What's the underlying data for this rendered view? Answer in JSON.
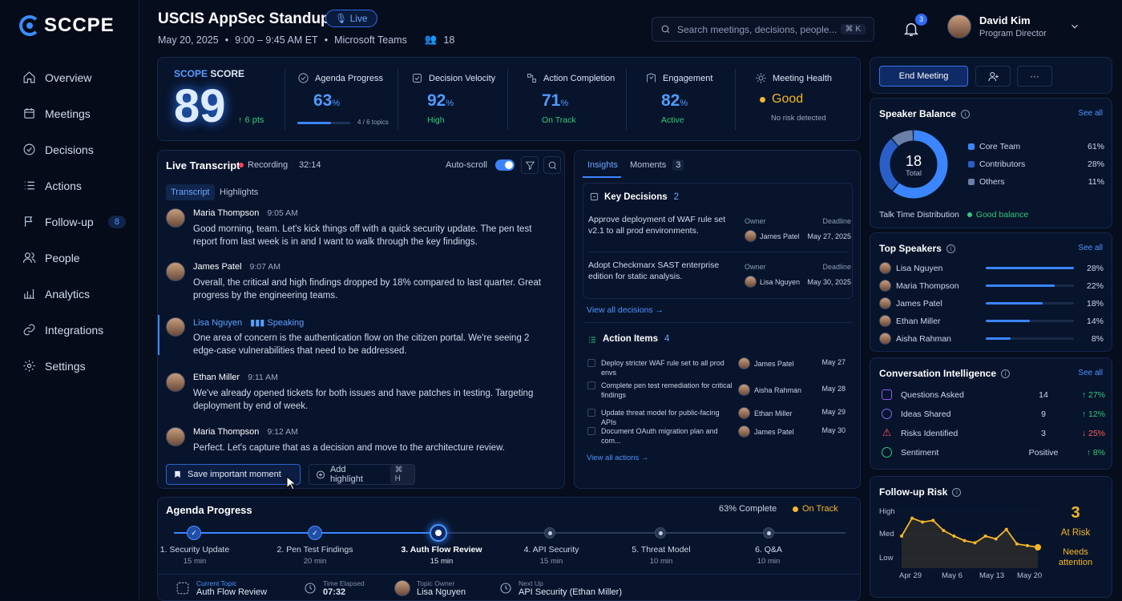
{
  "brand": {
    "logo_text": "SCCPE"
  },
  "nav": [
    {
      "label": "Overview",
      "icon": "home-icon"
    },
    {
      "label": "Meetings",
      "icon": "calendar-icon"
    },
    {
      "label": "Decisions",
      "icon": "check-circle-icon"
    },
    {
      "label": "Actions",
      "icon": "list-icon"
    },
    {
      "label": "Follow-up",
      "icon": "flag-icon",
      "badge": "8"
    },
    {
      "label": "People",
      "icon": "people-icon"
    },
    {
      "label": "Analytics",
      "icon": "analytics-icon"
    },
    {
      "label": "Integrations",
      "icon": "link-icon"
    },
    {
      "label": "Settings",
      "icon": "gear-icon"
    }
  ],
  "header": {
    "title": "USCIS AppSec Standup",
    "live": "Live",
    "date": "May 20, 2025",
    "time": "9:00 – 9:45 AM ET",
    "platform": "Microsoft Teams",
    "attendees": "18",
    "search_placeholder": "Search meetings, decisions, people...",
    "search_kbd": "⌘ K",
    "notifications": "3",
    "user_name": "David Kim",
    "user_role": "Program Director"
  },
  "kpi": {
    "scope_label_a": "SCOPE",
    "scope_label_b": "SCORE",
    "scope_value": "89",
    "scope_delta": "↑ 6 pts",
    "agenda": {
      "label": "Agenda Progress",
      "value": "63",
      "unit": "%",
      "sub": "4 / 6 topics",
      "fraction": 0.63
    },
    "velocity": {
      "label": "Decision Velocity",
      "value": "92",
      "unit": "%",
      "sub": "High"
    },
    "completion": {
      "label": "Action Completion",
      "value": "71",
      "unit": "%",
      "sub": "On Track"
    },
    "engagement": {
      "label": "Engagement",
      "value": "82",
      "unit": "%",
      "sub": "Active"
    },
    "health": {
      "label": "Meeting Health",
      "value": "Good",
      "sub": "No risk detected"
    }
  },
  "transcript": {
    "title": "Live Transcript",
    "recording": "Recording",
    "timer": "32:14",
    "autoscroll": "Auto-scroll",
    "tab_transcript": "Transcript",
    "tab_highlights": "Highlights",
    "messages": [
      {
        "name": "Maria Thompson",
        "time": "9:05 AM",
        "text": "Good morning, team. Let's kick things off with a quick security update. The pen test report from last week is in and I want to walk through the key findings."
      },
      {
        "name": "James Patel",
        "time": "9:07 AM",
        "text": "Overall, the critical and high findings dropped by 18% compared to last quarter. Great progress by the engineering teams."
      },
      {
        "name": "Lisa Nguyen",
        "time": "Speaking",
        "text": "One area of concern is the authentication flow on the citizen portal. We're seeing 2 edge-case vulnerabilities that need to be addressed."
      },
      {
        "name": "Ethan Miller",
        "time": "9:11 AM",
        "text": "We've already opened tickets for both issues and have patches in testing. Targeting deployment by end of week."
      },
      {
        "name": "Maria Thompson",
        "time": "9:12 AM",
        "text": "Perfect. Let's capture that as a decision and move to the architecture review."
      }
    ],
    "save_label": "Save important moment",
    "highlight_label": "Add highlight",
    "highlight_kbd": "⌘ H"
  },
  "insights": {
    "tab_insights": "Insights",
    "tab_moments": "Moments",
    "moments_count": "3",
    "decisions_title": "Key Decisions",
    "decisions_count": "2",
    "owner_label": "Owner",
    "deadline_label": "Deadline",
    "decisions": [
      {
        "text": "Approve deployment of WAF rule set v2.1 to all prod environments.",
        "owner": "James Patel",
        "deadline": "May 27, 2025"
      },
      {
        "text": "Adopt Checkmarx SAST enterprise edition for static analysis.",
        "owner": "Lisa Nguyen",
        "deadline": "May 30, 2025"
      }
    ],
    "view_decisions": "View all decisions →",
    "actions_title": "Action Items",
    "actions_count": "4",
    "actions": [
      {
        "text": "Deploy stricter WAF rule set to all prod envs",
        "owner": "James Patel",
        "date": "May 27"
      },
      {
        "text": "Complete pen test remediation for critical findings",
        "owner": "Aisha Rahman",
        "date": "May 28"
      },
      {
        "text": "Update threat model for public-facing APIs",
        "owner": "Ethan Miller",
        "date": "May 29"
      },
      {
        "text": "Document OAuth migration plan and com...",
        "owner": "James Patel",
        "date": "May 30"
      }
    ],
    "view_actions": "View all actions →"
  },
  "agenda": {
    "title": "Agenda Progress",
    "complete": "63% Complete",
    "status": "On Track",
    "steps": [
      {
        "label": "1. Security Update",
        "dur": "15 min",
        "state": "done"
      },
      {
        "label": "2. Pen Test Findings",
        "dur": "20 min",
        "state": "done"
      },
      {
        "label": "3. Auth Flow Review",
        "dur": "15 min",
        "state": "current"
      },
      {
        "label": "4. API Security",
        "dur": "15 min",
        "state": "future"
      },
      {
        "label": "5. Threat Model",
        "dur": "10 min",
        "state": "future"
      },
      {
        "label": "6. Q&A",
        "dur": "10 min",
        "state": "future"
      }
    ],
    "current_topic_label": "Current Topic",
    "current_topic": "Auth Flow Review",
    "elapsed_label": "Time Elapsed",
    "elapsed": "07:32",
    "owner_label": "Topic Owner",
    "owner": "Lisa Nguyen",
    "next_label": "Next Up",
    "next": "API Security (Ethan Miller)"
  },
  "controls": {
    "end_meeting": "End Meeting",
    "more": "···"
  },
  "speaker_balance": {
    "title": "Speaker Balance",
    "see_all": "See all",
    "total": "18",
    "total_label": "Total",
    "items": [
      {
        "label": "Core Team",
        "pct": "61%",
        "value": 61,
        "color": "#3b86ff"
      },
      {
        "label": "Contributors",
        "pct": "28%",
        "value": 28,
        "color": "#2b5fc8"
      },
      {
        "label": "Others",
        "pct": "11%",
        "value": 11,
        "color": "#6b7fa8"
      }
    ],
    "talk_time": "Talk Time Distribution",
    "balance": "Good balance"
  },
  "top_speakers": {
    "title": "Top Speakers",
    "see_all": "See all",
    "items": [
      {
        "name": "Lisa Nguyen",
        "pct": "28%",
        "value": 0.28
      },
      {
        "name": "Maria Thompson",
        "pct": "22%",
        "value": 0.22
      },
      {
        "name": "James Patel",
        "pct": "18%",
        "value": 0.18
      },
      {
        "name": "Ethan Miller",
        "pct": "14%",
        "value": 0.14
      },
      {
        "name": "Aisha Rahman",
        "pct": "8%",
        "value": 0.08
      }
    ]
  },
  "conv": {
    "title": "Conversation Intelligence",
    "see_all": "See all",
    "items": [
      {
        "label": "Questions Asked",
        "value": "14",
        "delta": "↑ 27%",
        "dir": "up",
        "color": "#8a5cf6"
      },
      {
        "label": "Ideas Shared",
        "value": "9",
        "delta": "↑ 12%",
        "dir": "up",
        "color": "#7c6cf0"
      },
      {
        "label": "Risks Identified",
        "value": "3",
        "delta": "↓ 25%",
        "dir": "down",
        "color": "#ff4d5e"
      },
      {
        "label": "Sentiment",
        "value": "Positive",
        "delta": "↑ 8%",
        "dir": "up",
        "color": "#31c97a"
      }
    ]
  },
  "followup": {
    "title": "Follow-up Risk",
    "levels": [
      "High",
      "Med",
      "Low"
    ],
    "x_labels": [
      "Apr 29",
      "May 6",
      "May 13",
      "May 20"
    ],
    "count": "3",
    "status": "At Risk",
    "note": "Needs attention",
    "series": [
      0.5,
      0.82,
      0.75,
      0.78,
      0.6,
      0.5,
      0.42,
      0.38,
      0.5,
      0.45,
      0.62,
      0.36,
      0.33,
      0.3
    ]
  }
}
